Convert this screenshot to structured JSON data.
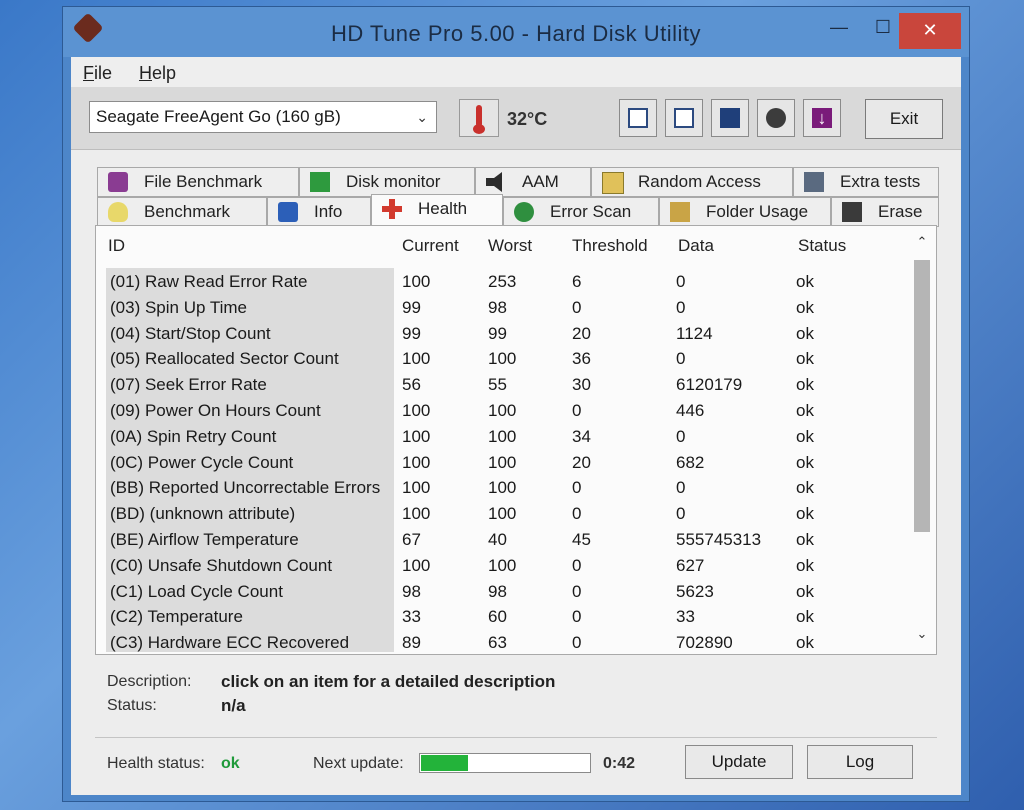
{
  "window": {
    "title": "HD Tune Pro 5.00 - Hard Disk Utility",
    "min_symbol": "—",
    "max_symbol": "☐",
    "close_symbol": "✕"
  },
  "menu": [
    "File",
    "Help"
  ],
  "toolbar": {
    "drive": "Seagate FreeAgent Go (160 gB)",
    "dropdown_arrow": "⌄",
    "temperature": "32°C",
    "buttons": [
      "copy-text-icon",
      "copy-info-icon",
      "save-icon",
      "options-icon",
      "download-icon"
    ],
    "exit_label": "Exit"
  },
  "tabs_top": [
    "File Benchmark",
    "Disk monitor",
    "AAM",
    "Random Access",
    "Extra tests"
  ],
  "tabs_bottom": [
    "Benchmark",
    "Info",
    "Health",
    "Error Scan",
    "Folder Usage",
    "Erase"
  ],
  "active_tab": "Health",
  "health": {
    "columns": [
      "ID",
      "Current",
      "Worst",
      "Threshold",
      "Data",
      "Status"
    ],
    "rows": [
      [
        "(01) Raw Read Error Rate",
        "100",
        "253",
        "6",
        "0",
        "ok"
      ],
      [
        "(03) Spin Up Time",
        "99",
        "98",
        "0",
        "0",
        "ok"
      ],
      [
        "(04) Start/Stop Count",
        "99",
        "99",
        "20",
        "1124",
        "ok"
      ],
      [
        "(05) Reallocated Sector Count",
        "100",
        "100",
        "36",
        "0",
        "ok"
      ],
      [
        "(07) Seek Error Rate",
        "56",
        "55",
        "30",
        "6120179",
        "ok"
      ],
      [
        "(09) Power On Hours Count",
        "100",
        "100",
        "0",
        "446",
        "ok"
      ],
      [
        "(0A) Spin Retry Count",
        "100",
        "100",
        "34",
        "0",
        "ok"
      ],
      [
        "(0C) Power Cycle Count",
        "100",
        "100",
        "20",
        "682",
        "ok"
      ],
      [
        "(BB) Reported Uncorrectable Errors",
        "100",
        "100",
        "0",
        "0",
        "ok"
      ],
      [
        "(BD) (unknown attribute)",
        "100",
        "100",
        "0",
        "0",
        "ok"
      ],
      [
        "(BE) Airflow Temperature",
        "67",
        "40",
        "45",
        "555745313",
        "ok"
      ],
      [
        "(C0) Unsafe Shutdown Count",
        "100",
        "100",
        "0",
        "627",
        "ok"
      ],
      [
        "(C1) Load Cycle Count",
        "98",
        "98",
        "0",
        "5623",
        "ok"
      ],
      [
        "(C2) Temperature",
        "33",
        "60",
        "0",
        "33",
        "ok"
      ],
      [
        "(C3) Hardware ECC Recovered",
        "89",
        "63",
        "0",
        "702890",
        "ok"
      ]
    ],
    "scroll_up": "⌃",
    "scroll_down": "⌄"
  },
  "description": {
    "label": "Description:",
    "value": "click on an item for a detailed description",
    "status_label": "Status:",
    "status_value": "n/a"
  },
  "statusbar": {
    "health_label": "Health status:",
    "health_value": "ok",
    "next_update_label": "Next update:",
    "progress_fraction": 0.28,
    "countdown": "0:42",
    "update_label": "Update",
    "log_label": "Log"
  },
  "colors": {
    "accent_green": "#23b33a",
    "close_red": "#c9463c",
    "title_bar": "#5b93d2"
  }
}
